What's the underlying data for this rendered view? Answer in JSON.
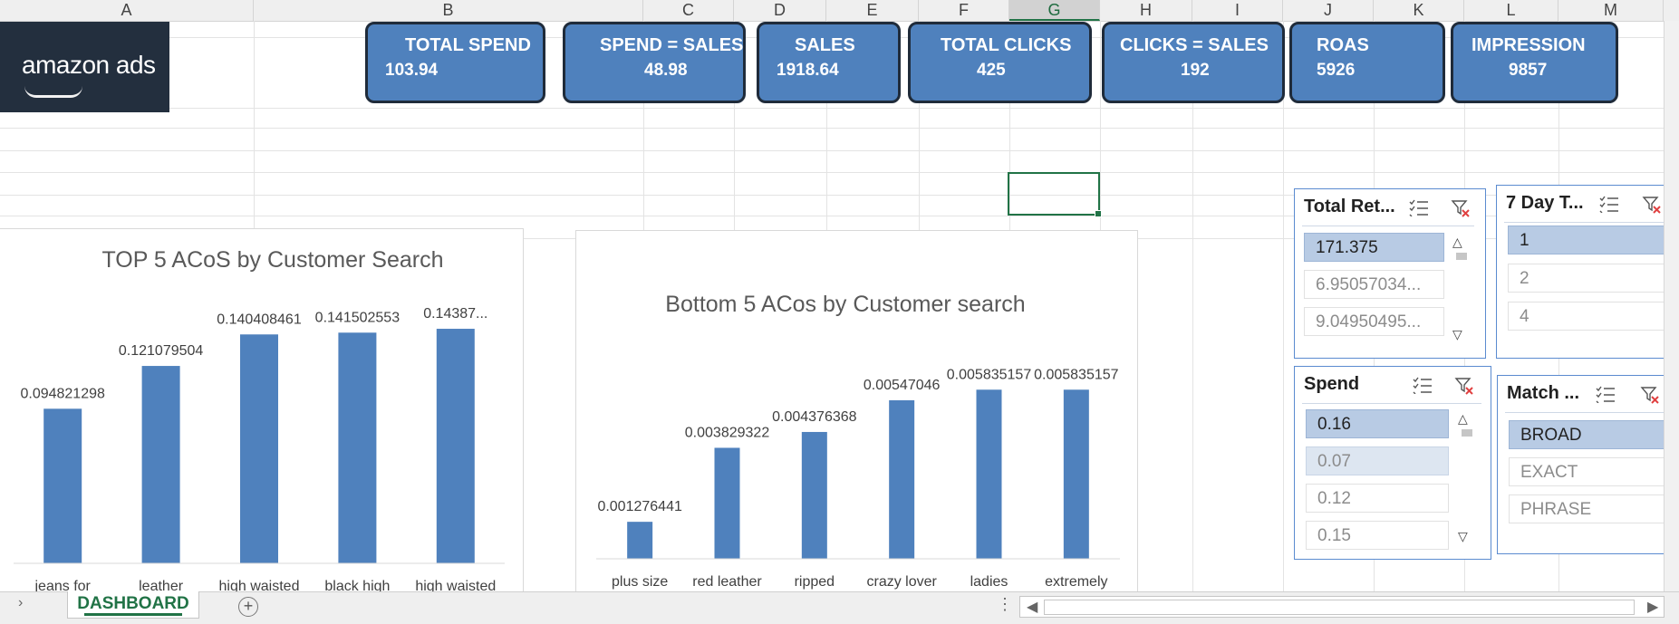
{
  "columns": [
    "A",
    "B",
    "C",
    "D",
    "E",
    "F",
    "G",
    "H",
    "I",
    "J",
    "K",
    "L",
    "M"
  ],
  "selected_column": "G",
  "logo": {
    "text": "amazon ads"
  },
  "kpis": [
    {
      "title": "TOTAL SPEND",
      "value": "103.94"
    },
    {
      "title": "SPEND = SALES",
      "value": "48.98"
    },
    {
      "title": "SALES",
      "value": "1918.64"
    },
    {
      "title": "TOTAL CLICKS",
      "value": "425"
    },
    {
      "title": "CLICKS = SALES",
      "value": "192"
    },
    {
      "title": "ROAS",
      "value": "5926"
    },
    {
      "title": "IMPRESSION",
      "value": "9857"
    }
  ],
  "chart_data": [
    {
      "type": "bar",
      "title": "TOP 5 ACoS by Customer Search",
      "categories": [
        "jeans for",
        "leather",
        "high waisted",
        "black high",
        "high waisted"
      ],
      "values": [
        0.094821298,
        0.121079504,
        0.140408461,
        0.141502553,
        0.14387
      ],
      "data_labels": [
        "0.094821298",
        "0.121079504",
        "0.140408461",
        "0.141502553",
        "0.14387..."
      ],
      "ylim": [
        0,
        0.15
      ],
      "color": "#4f81bd"
    },
    {
      "type": "bar",
      "title": "Bottom 5 ACos by Customer search",
      "categories": [
        "plus size",
        "red leather",
        "ripped",
        "crazy lover",
        "ladies",
        "extremely"
      ],
      "values": [
        0.001276441,
        0.003829322,
        0.004376368,
        0.00547046,
        0.005835157,
        0.005835157
      ],
      "data_labels": [
        "0.001276441",
        "0.003829322",
        "0.004376368",
        "0.00547046",
        "0.005835157",
        "0.005835157"
      ],
      "ylim": [
        0,
        0.0065
      ],
      "color": "#4f81bd"
    }
  ],
  "slicers": {
    "total_ret": {
      "title": "Total Ret...",
      "items": [
        "171.375",
        "6.95057034...",
        "9.04950495..."
      ]
    },
    "spend": {
      "title": "Spend",
      "items": [
        "0.16",
        "0.07",
        "0.12",
        "0.15"
      ]
    },
    "seven_day": {
      "title": "7 Day T...",
      "items": [
        "1",
        "2",
        "4"
      ]
    },
    "match": {
      "title": "Match ...",
      "items": [
        "BROAD",
        "EXACT",
        "PHRASE"
      ]
    }
  },
  "sheet_tab": "DASHBOARD",
  "add_sheet": "+"
}
